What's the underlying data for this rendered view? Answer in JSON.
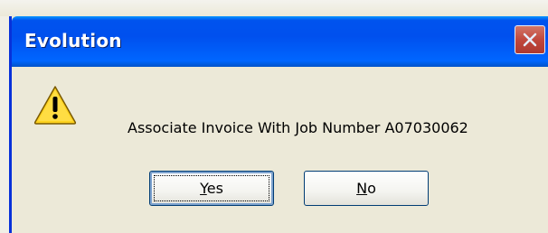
{
  "dialog": {
    "title": "Evolution",
    "icon": "warning-icon",
    "message": "Associate Invoice With Job Number A07030062",
    "buttons": {
      "yes": {
        "mnemonic": "Y",
        "rest": "es"
      },
      "no": {
        "mnemonic": "N",
        "rest": "o"
      }
    },
    "colors": {
      "titlebar": "#0050ee",
      "body": "#ece9d8",
      "close_button": "#d6472a",
      "warning_fill": "#ffd21f"
    }
  }
}
